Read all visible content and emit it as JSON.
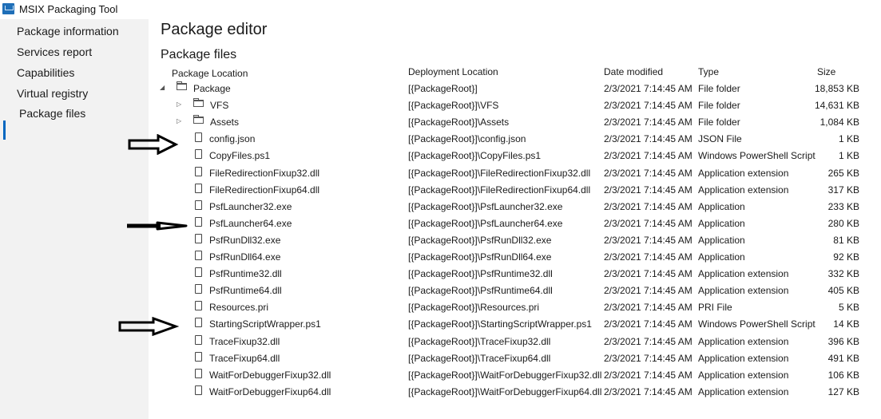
{
  "app": {
    "title": "MSIX Packaging Tool"
  },
  "sidebar": {
    "items": [
      {
        "label": "Package information"
      },
      {
        "label": "Services report"
      },
      {
        "label": "Capabilities"
      },
      {
        "label": "Virtual registry"
      },
      {
        "label": "Package files"
      }
    ],
    "selected": "Package files"
  },
  "main": {
    "page_title": "Package editor",
    "section_title": "Package files",
    "columns": {
      "location": "Package Location",
      "deployment": "Deployment Location",
      "date": "Date modified",
      "type": "Type",
      "size": "Size"
    },
    "rows": [
      {
        "name": "Package",
        "deployment": "[{PackageRoot}]",
        "date": "2/3/2021 7:14:45 AM",
        "type": "File folder",
        "size": "18,853 KB",
        "kind": "folder",
        "expander": "expanded"
      },
      {
        "name": "VFS",
        "deployment": "[{PackageRoot}]\\VFS",
        "date": "2/3/2021 7:14:45 AM",
        "type": "File folder",
        "size": "14,631 KB",
        "kind": "folder",
        "expander": "collapsed"
      },
      {
        "name": "Assets",
        "deployment": "[{PackageRoot}]\\Assets",
        "date": "2/3/2021 7:14:45 AM",
        "type": "File folder",
        "size": "1,084 KB",
        "kind": "folder",
        "expander": "collapsed"
      },
      {
        "name": "config.json",
        "deployment": "[{PackageRoot}]\\config.json",
        "date": "2/3/2021 7:14:45 AM",
        "type": "JSON File",
        "size": "1 KB",
        "kind": "file"
      },
      {
        "name": "CopyFiles.ps1",
        "deployment": "[{PackageRoot}]\\CopyFiles.ps1",
        "date": "2/3/2021 7:14:45 AM",
        "type": "Windows PowerShell Script",
        "size": "1 KB",
        "kind": "file"
      },
      {
        "name": "FileRedirectionFixup32.dll",
        "deployment": "[{PackageRoot}]\\FileRedirectionFixup32.dll",
        "date": "2/3/2021 7:14:45 AM",
        "type": "Application extension",
        "size": "265 KB",
        "kind": "file"
      },
      {
        "name": "FileRedirectionFixup64.dll",
        "deployment": "[{PackageRoot}]\\FileRedirectionFixup64.dll",
        "date": "2/3/2021 7:14:45 AM",
        "type": "Application extension",
        "size": "317 KB",
        "kind": "file"
      },
      {
        "name": "PsfLauncher32.exe",
        "deployment": "[{PackageRoot}]\\PsfLauncher32.exe",
        "date": "2/3/2021 7:14:45 AM",
        "type": "Application",
        "size": "233 KB",
        "kind": "file"
      },
      {
        "name": "PsfLauncher64.exe",
        "deployment": "[{PackageRoot}]\\PsfLauncher64.exe",
        "date": "2/3/2021 7:14:45 AM",
        "type": "Application",
        "size": "280 KB",
        "kind": "file"
      },
      {
        "name": "PsfRunDll32.exe",
        "deployment": "[{PackageRoot}]\\PsfRunDll32.exe",
        "date": "2/3/2021 7:14:45 AM",
        "type": "Application",
        "size": "81 KB",
        "kind": "file"
      },
      {
        "name": "PsfRunDll64.exe",
        "deployment": "[{PackageRoot}]\\PsfRunDll64.exe",
        "date": "2/3/2021 7:14:45 AM",
        "type": "Application",
        "size": "92 KB",
        "kind": "file"
      },
      {
        "name": "PsfRuntime32.dll",
        "deployment": "[{PackageRoot}]\\PsfRuntime32.dll",
        "date": "2/3/2021 7:14:45 AM",
        "type": "Application extension",
        "size": "332 KB",
        "kind": "file"
      },
      {
        "name": "PsfRuntime64.dll",
        "deployment": "[{PackageRoot}]\\PsfRuntime64.dll",
        "date": "2/3/2021 7:14:45 AM",
        "type": "Application extension",
        "size": "405 KB",
        "kind": "file"
      },
      {
        "name": "Resources.pri",
        "deployment": "[{PackageRoot}]\\Resources.pri",
        "date": "2/3/2021 7:14:45 AM",
        "type": "PRI File",
        "size": "5 KB",
        "kind": "file"
      },
      {
        "name": "StartingScriptWrapper.ps1",
        "deployment": "[{PackageRoot}]\\StartingScriptWrapper.ps1",
        "date": "2/3/2021 7:14:45 AM",
        "type": "Windows PowerShell Script",
        "size": "14 KB",
        "kind": "file"
      },
      {
        "name": "TraceFixup32.dll",
        "deployment": "[{PackageRoot}]\\TraceFixup32.dll",
        "date": "2/3/2021 7:14:45 AM",
        "type": "Application extension",
        "size": "396 KB",
        "kind": "file"
      },
      {
        "name": "TraceFixup64.dll",
        "deployment": "[{PackageRoot}]\\TraceFixup64.dll",
        "date": "2/3/2021 7:14:45 AM",
        "type": "Application extension",
        "size": "491 KB",
        "kind": "file"
      },
      {
        "name": "WaitForDebuggerFixup32.dll",
        "deployment": "[{PackageRoot}]\\WaitForDebuggerFixup32.dll",
        "date": "2/3/2021 7:14:45 AM",
        "type": "Application extension",
        "size": "106 KB",
        "kind": "file"
      },
      {
        "name": "WaitForDebuggerFixup64.dll",
        "deployment": "[{PackageRoot}]\\WaitForDebuggerFixup64.dll",
        "date": "2/3/2021 7:14:45 AM",
        "type": "Application extension",
        "size": "127 KB",
        "kind": "file"
      }
    ]
  },
  "annotations": {
    "arrows_point_to": [
      "config.json",
      "PsfLauncher64.exe",
      "StartingScriptWrapper.ps1"
    ]
  },
  "colors": {
    "accent": "#0067c0",
    "sidebar_bg": "#f2f2f2"
  }
}
